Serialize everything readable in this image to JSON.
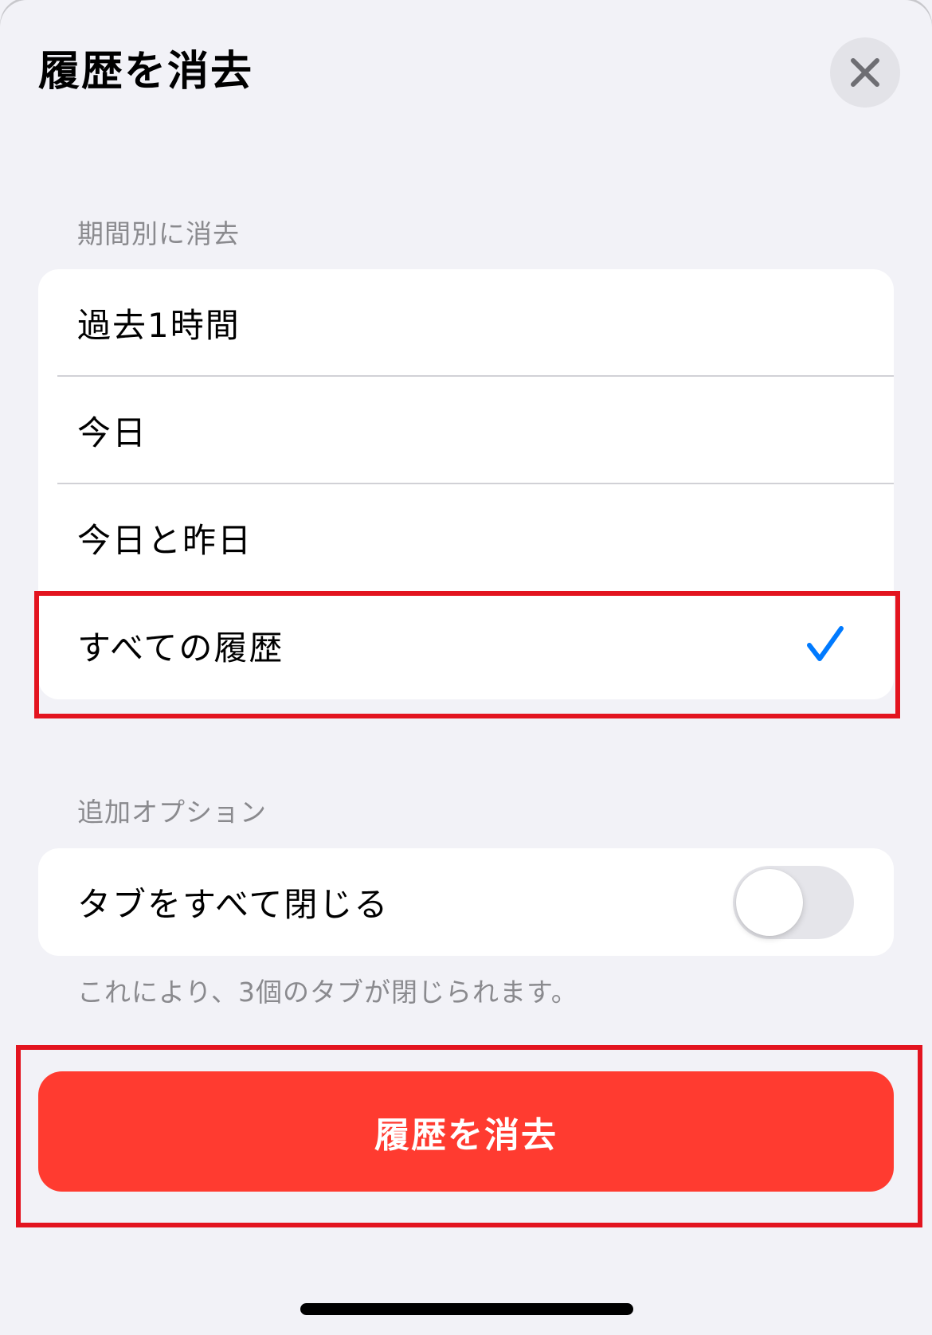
{
  "sheet": {
    "title": "履歴を消去",
    "close_icon": "close-icon"
  },
  "timeframe": {
    "header": "期間別に消去",
    "options": [
      {
        "label": "過去1時間",
        "selected": false
      },
      {
        "label": "今日",
        "selected": false
      },
      {
        "label": "今日と昨日",
        "selected": false
      },
      {
        "label": "すべての履歴",
        "selected": true
      }
    ]
  },
  "additional": {
    "header": "追加オプション",
    "close_tabs_label": "タブをすべて閉じる",
    "close_tabs_enabled": false,
    "note": "これにより、3個のタブが閉じられます。"
  },
  "action": {
    "clear_label": "履歴を消去"
  },
  "colors": {
    "accent": "#007aff",
    "destructive": "#ff3b30",
    "highlight": "#e3141f"
  }
}
